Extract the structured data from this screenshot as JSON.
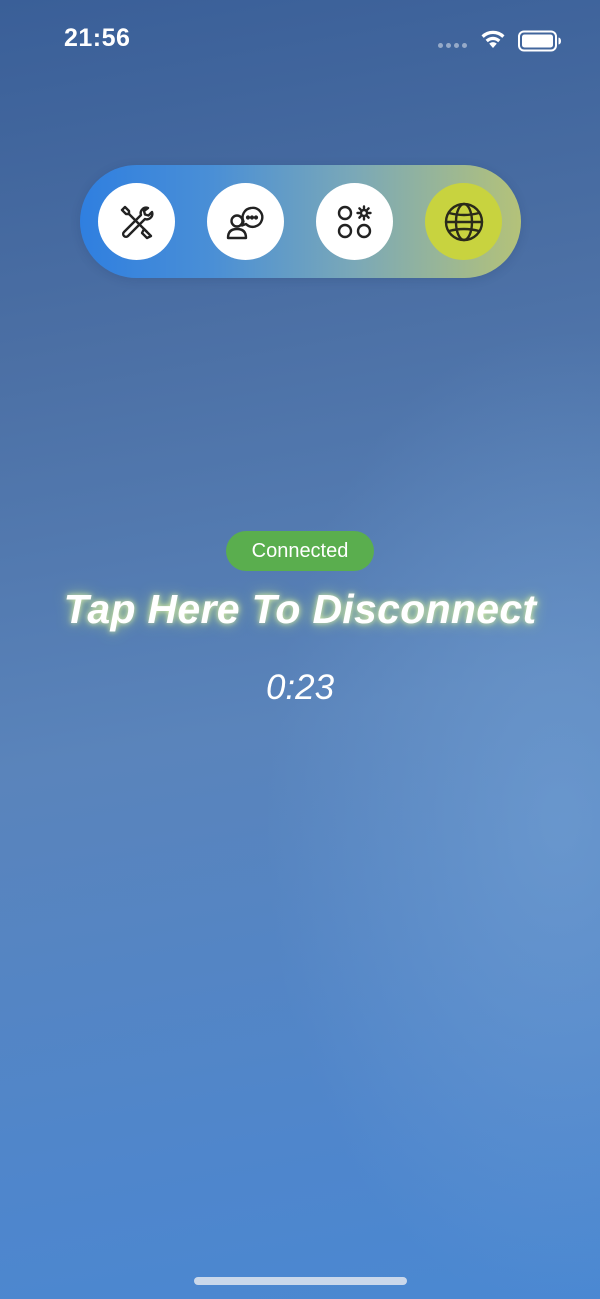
{
  "status_bar": {
    "time": "21:56"
  },
  "tab_bar": {
    "items": [
      {
        "icon": "tools-icon",
        "active": false
      },
      {
        "icon": "user-chat-icon",
        "active": false
      },
      {
        "icon": "apps-settings-icon",
        "active": false
      },
      {
        "icon": "globe-icon",
        "active": true
      }
    ],
    "active_color": "#c8d33f"
  },
  "connection": {
    "status_label": "Connected",
    "status_color": "#5aae4e",
    "action_label": "Tap Here To Disconnect",
    "elapsed": "0:23"
  }
}
